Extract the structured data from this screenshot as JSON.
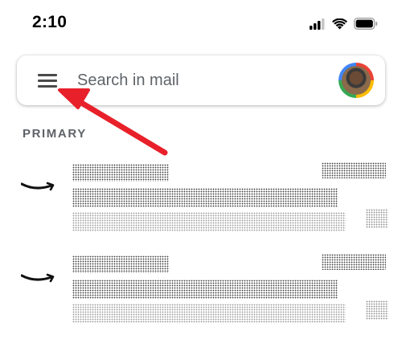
{
  "status_bar": {
    "time": "2:10",
    "icons": [
      "cellular-signal-icon",
      "wifi-icon",
      "battery-icon"
    ]
  },
  "search_bar": {
    "placeholder": "Search in mail",
    "menu_icon": "hamburger-menu-icon",
    "avatar": "account-avatar"
  },
  "section": {
    "label": "PRIMARY"
  },
  "mail_list": [
    {
      "sender_icon": "amazon-logo-icon",
      "content": "redacted"
    },
    {
      "sender_icon": "amazon-logo-icon",
      "content": "redacted"
    }
  ],
  "colors": {
    "annotation_arrow": "#e8202a",
    "google_red": "#ea4335",
    "google_yellow": "#fbbc05",
    "google_green": "#34a853",
    "google_blue": "#4285f4"
  }
}
